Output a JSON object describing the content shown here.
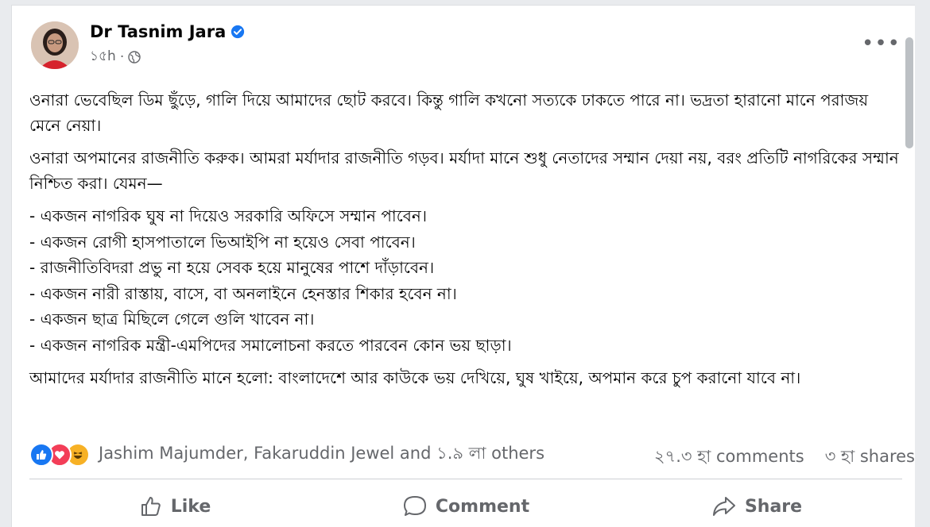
{
  "post": {
    "author": "Dr Tasnim Jara",
    "time": "১৫h",
    "dot": "·",
    "more": "•••",
    "paragraphs": [
      "ওনারা ভেবেছিল ডিম ছুঁড়ে, গালি দিয়ে আমাদের ছোট করবে। কিন্তু গালি কখনো সত্যকে ঢাকতে পারে না। ভদ্রতা হারানো মানে পরাজয় মেনে নেয়া।",
      "ওনারা অপমানের রাজনীতি করুক। আমরা মর্যাদার রাজনীতি গড়ব। মর্যাদা মানে শুধু নেতাদের সম্মান দেয়া নয়, বরং প্রতিটি নাগরিকের সম্মান নিশ্চিত করা। যেমন—"
    ],
    "list": [
      "- একজন নাগরিক ঘুষ না দিয়েও সরকারি অফিসে সম্মান পাবেন।",
      "- একজন রোগী হাসপাতালে ভিআইপি না হয়েও সেবা পাবেন।",
      "- রাজনীতিবিদরা প্রভু না হয়ে সেবক হয়ে মানুষের পাশে দাঁড়াবেন।",
      "- একজন নারী রাস্তায়, বাসে, বা অনলাইনে হেনস্তার শিকার হবেন না।",
      "- একজন ছাত্র মিছিলে গেলে গুলি খাবেন না।",
      "- একজন নাগরিক মন্ত্রী-এমপিদের সমালোচনা করতে পারবেন কোন ভয় ছাড়া।"
    ],
    "closing": "আমাদের মর্যাদার রাজনীতি মানে হলো: বাংলাদেশে আর কাউকে ভয় দেখিয়ে, ঘুষ খাইয়ে, অপমান করে চুপ করানো যাবে না।"
  },
  "engagement": {
    "reactions_text": "Jashim Majumder, Fakaruddin Jewel and ১.৯ লা others",
    "comments": "২৭.৩ হা comments",
    "shares": "৩ হা shares"
  },
  "actions": {
    "like": "Like",
    "comment": "Comment",
    "share": "Share"
  },
  "colors": {
    "like_blue": "#1877f2",
    "love_red": "#f33e58",
    "haha_yellow": "#f7b125",
    "secondary_text": "#65676b"
  }
}
